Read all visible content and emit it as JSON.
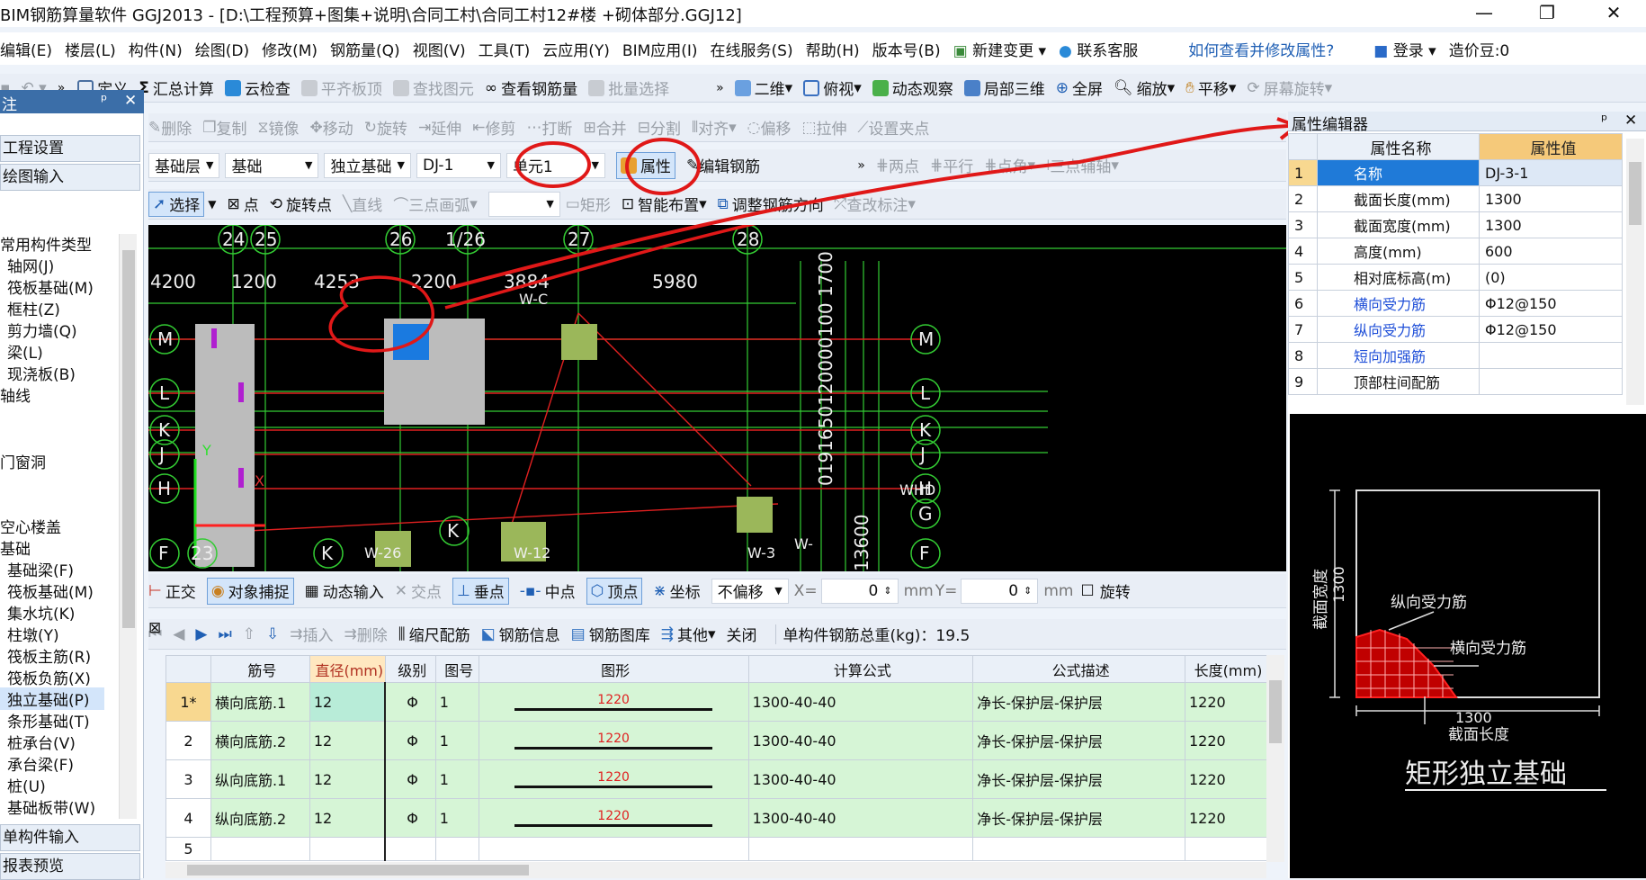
{
  "window": {
    "title": "BIM钢筋算量软件 GGJ2013 - [D:\\工程预算+图集+说明\\合同工村\\合同工村12#楼 +砌体部分.GGJ12]",
    "minimize": "—",
    "restore": "❐",
    "close": "✕"
  },
  "menu": {
    "items": [
      "编辑(E)",
      "楼层(L)",
      "构件(N)",
      "绘图(D)",
      "修改(M)",
      "钢筋量(Q)",
      "视图(V)",
      "工具(T)",
      "云应用(Y)",
      "BIM应用(I)",
      "在线服务(S)",
      "帮助(H)",
      "版本号(B)"
    ],
    "new_change": "新建变更",
    "contact": "联系客服",
    "help_link": "如何查看并修改属性?",
    "login": "登录",
    "cost_beans": "造价豆:0"
  },
  "toolbar1": {
    "more": "»",
    "define": "定义",
    "summary": "汇总计算",
    "cloud_check": "云检查",
    "level_top": "平齐板顶",
    "find": "查找图元",
    "view_rebar": "查看钢筋量",
    "batch_select": "批量选择",
    "view_2d": "二维",
    "top_view": "俯视",
    "dynamic": "动态观察",
    "local_3d": "局部三维",
    "full_screen": "全屏",
    "zoom": "缩放",
    "pan": "平移",
    "rotate_screen": "屏幕旋转"
  },
  "toolbar2": {
    "delete": "删除",
    "copy": "复制",
    "mirror": "镜像",
    "move": "移动",
    "rotate": "旋转",
    "extend": "延伸",
    "trim": "修剪",
    "break": "打断",
    "merge": "合并",
    "split": "分割",
    "align": "对齐",
    "offset": "偏移",
    "stretch": "拉伸",
    "set_grip": "设置夹点"
  },
  "toolbar3": {
    "layer": "基础层",
    "type": "基础",
    "component": "独立基础",
    "name": "DJ-1",
    "unit": "单元1",
    "property": "属性",
    "edit_rebar": "编辑钢筋",
    "two_points": "两点",
    "parallel": "平行",
    "point_angle": "点角",
    "three_point_axis": "三点辅轴"
  },
  "toolbar4": {
    "select": "选择",
    "point": "点",
    "rotate_point": "旋转点",
    "line": "直线",
    "arc3": "三点画弧",
    "rect": "矩形",
    "smart": "智能布置",
    "adjust_dir": "调整钢筋方向",
    "edit_mark": "查改标注"
  },
  "left_panel": {
    "header": "注",
    "project_settings": "工程设置",
    "draw_input": "绘图输入",
    "tree": [
      "常用构件类型",
      "轴网(J)",
      "筏板基础(M)",
      "框柱(Z)",
      "剪力墙(Q)",
      "梁(L)",
      "现浇板(B)",
      "轴线",
      "门窗洞",
      "空心楼盖",
      "基础",
      "基础梁(F)",
      "筏板基础(M)",
      "集水坑(K)",
      "柱墩(Y)",
      "筏板主筋(R)",
      "筏板负筋(X)",
      "独立基础(P)",
      "条形基础(T)",
      "桩承台(V)",
      "承台梁(F)",
      "桩(U)",
      "基础板带(W)"
    ],
    "single_input": "单构件输入",
    "report_preview": "报表预览"
  },
  "canvas": {
    "axis_top": [
      "24",
      "25",
      "26",
      "1/26",
      "27",
      "28"
    ],
    "dims": [
      "4200",
      "1200",
      "4253",
      "2200",
      "3884",
      "5980"
    ],
    "axis_left": [
      "M",
      "L",
      "K",
      "J",
      "H",
      "F",
      "23"
    ],
    "axis_right": [
      "M",
      "L",
      "K",
      "J",
      "H",
      "G",
      "F"
    ],
    "axis_bottom": [
      "K",
      "K"
    ],
    "labels": [
      "W-C",
      "W-26",
      "W-12",
      "W-3",
      "W-",
      "WHD"
    ],
    "vert_dim": "0191650120000100 1700",
    "vert_dim2": "13600",
    "y_label": "Y",
    "x_label": "X"
  },
  "status_bar": {
    "ortho": "正交",
    "snap": "对象捕捉",
    "dynamic_input": "动态输入",
    "intersect": "交点",
    "perp": "垂点",
    "midpoint": "中点",
    "vertex": "顶点",
    "coord": "坐标",
    "offset_mode": "不偏移",
    "x_label": "X=",
    "x_value": "0",
    "y_label": "Y=",
    "y_value": "0",
    "unit": "mm",
    "rotate": "旋转"
  },
  "grid_toolbar": {
    "insert": "插入",
    "delete": "删除",
    "scale_rebar": "缩尺配筋",
    "rebar_info": "钢筋信息",
    "rebar_lib": "钢筋图库",
    "other": "其他",
    "close": "关闭",
    "total": "单构件钢筋总重(kg)：19.5"
  },
  "grid": {
    "headers": [
      "筋号",
      "直径(mm)",
      "级别",
      "图号",
      "图形",
      "计算公式",
      "公式描述",
      "长度(mm)"
    ],
    "rows": [
      {
        "idx": "1*",
        "name": "横向底筋.1",
        "dia": "12",
        "grade": "Φ",
        "fig": "1",
        "shape": "1220",
        "formula": "1300-40-40",
        "desc": "净长-保护层-保护层",
        "len": "1220"
      },
      {
        "idx": "2",
        "name": "横向底筋.2",
        "dia": "12",
        "grade": "Φ",
        "fig": "1",
        "shape": "1220",
        "formula": "1300-40-40",
        "desc": "净长-保护层-保护层",
        "len": "1220"
      },
      {
        "idx": "3",
        "name": "纵向底筋.1",
        "dia": "12",
        "grade": "Φ",
        "fig": "1",
        "shape": "1220",
        "formula": "1300-40-40",
        "desc": "净长-保护层-保护层",
        "len": "1220"
      },
      {
        "idx": "4",
        "name": "纵向底筋.2",
        "dia": "12",
        "grade": "Φ",
        "fig": "1",
        "shape": "1220",
        "formula": "1300-40-40",
        "desc": "净长-保护层-保护层",
        "len": "1220"
      },
      {
        "idx": "5",
        "name": "",
        "dia": "",
        "grade": "",
        "fig": "",
        "shape": "",
        "formula": "",
        "desc": "",
        "len": ""
      }
    ]
  },
  "prop_editor": {
    "title": "属性编辑器",
    "pin": "ᵖ",
    "close": "✕",
    "col_name": "属性名称",
    "col_value": "属性值",
    "rows": [
      {
        "idx": "1",
        "name": "名称",
        "value": "DJ-3-1"
      },
      {
        "idx": "2",
        "name": "截面长度(mm)",
        "value": "1300"
      },
      {
        "idx": "3",
        "name": "截面宽度(mm)",
        "value": "1300"
      },
      {
        "idx": "4",
        "name": "高度(mm)",
        "value": "600"
      },
      {
        "idx": "5",
        "name": "相对底标高(m)",
        "value": "(0)"
      },
      {
        "idx": "6",
        "name": "横向受力筋",
        "value": "Φ12@150"
      },
      {
        "idx": "7",
        "name": "纵向受力筋",
        "value": "Φ12@150"
      },
      {
        "idx": "8",
        "name": "短向加强筋",
        "value": ""
      },
      {
        "idx": "9",
        "name": "顶部柱间配筋",
        "value": ""
      }
    ]
  },
  "preview": {
    "width_label": "截面宽度",
    "width_val": "1300",
    "long_rebar": "纵向受力筋",
    "trans_rebar": "横向受力筋",
    "len_val": "1300",
    "len_label": "截面长度",
    "title": "矩形独立基础"
  },
  "colors": {
    "accent": "#3b6ea8",
    "annotation": "#e0201a",
    "grid_row": "#d6f5d6",
    "prop_header": "#f5c97a"
  }
}
